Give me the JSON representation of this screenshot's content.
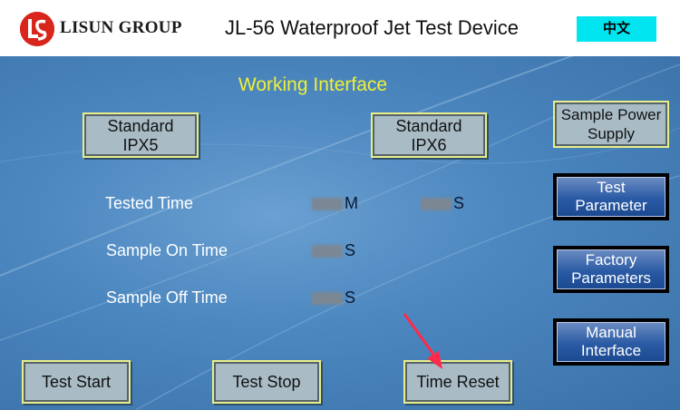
{
  "header": {
    "logo_text": "LISUN GROUP",
    "title": "JL-56 Waterproof Jet Test Device",
    "lang_button": "中文"
  },
  "main": {
    "section_title": "Working Interface",
    "standard_ipx5": {
      "line1": "Standard",
      "line2": "IPX5"
    },
    "standard_ipx6": {
      "line1": "Standard",
      "line2": "IPX6"
    },
    "readouts": {
      "tested_time_label": "Tested Time",
      "tested_time_min_unit": "M",
      "tested_time_sec_unit": "S",
      "sample_on_label": "Sample On Time",
      "sample_on_unit": "S",
      "sample_off_label": "Sample Off Time",
      "sample_off_unit": "S"
    }
  },
  "side_buttons": {
    "sample_power": {
      "line1": "Sample Power",
      "line2": "Supply"
    },
    "test_parameter": {
      "line1": "Test",
      "line2": "Parameter"
    },
    "factory_parameters": {
      "line1": "Factory",
      "line2": "Parameters"
    },
    "manual_interface": {
      "line1": "Manual",
      "line2": "Interface"
    }
  },
  "bottom_buttons": {
    "test_start": "Test Start",
    "test_stop": "Test Stop",
    "time_reset": "Time Reset"
  },
  "colors": {
    "accent_title": "#f0f038",
    "background": "#4d88c0",
    "lang_button_bg": "#00e5f0",
    "logo_red": "#d9261c",
    "arrow": "#ff2a4a"
  }
}
